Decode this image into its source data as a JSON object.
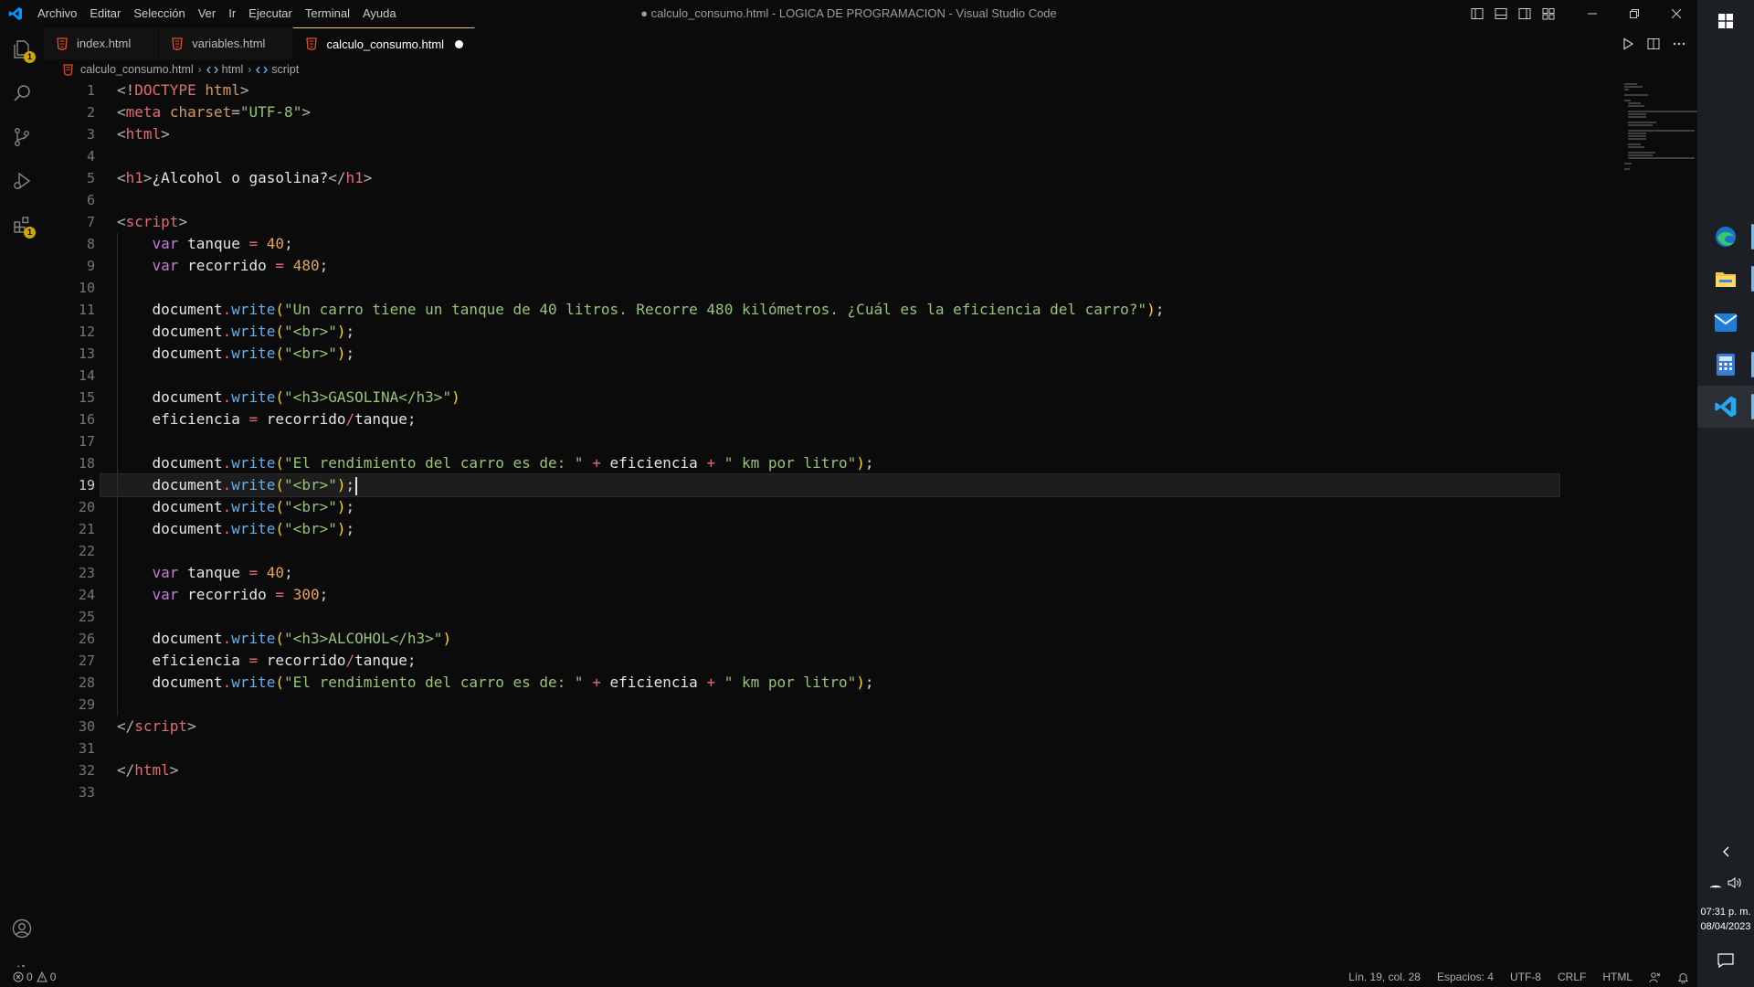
{
  "titlebar": {
    "menu": [
      "Archivo",
      "Editar",
      "Selección",
      "Ver",
      "Ir",
      "Ejecutar",
      "Terminal",
      "Ayuda"
    ],
    "window_title": "● calculo_consumo.html - LOGICA DE PROGRAMACION - Visual Studio Code"
  },
  "activity_bar": {
    "explorer_badge": "1",
    "extensions_badge": "1"
  },
  "tabs": [
    {
      "label": "index.html",
      "active": false,
      "dirty": false
    },
    {
      "label": "variables.html",
      "active": false,
      "dirty": false
    },
    {
      "label": "calculo_consumo.html",
      "active": true,
      "dirty": true
    }
  ],
  "breadcrumb": {
    "file": "calculo_consumo.html",
    "node1": "html",
    "node2": "script"
  },
  "editor": {
    "active_line": 19,
    "lines": [
      [
        [
          "p",
          "<!"
        ],
        [
          "t",
          "DOCTYPE"
        ],
        [
          "p",
          " "
        ],
        [
          "a",
          "html"
        ],
        [
          "p",
          ">"
        ]
      ],
      [
        [
          "p",
          "<"
        ],
        [
          "t",
          "meta"
        ],
        [
          "p",
          " "
        ],
        [
          "a",
          "charset"
        ],
        [
          "p",
          "="
        ],
        [
          "s",
          "\"UTF-8\""
        ],
        [
          "p",
          ">"
        ]
      ],
      [
        [
          "p",
          "<"
        ],
        [
          "t",
          "html"
        ],
        [
          "p",
          ">"
        ]
      ],
      [],
      [
        [
          "p",
          "<"
        ],
        [
          "t",
          "h1"
        ],
        [
          "p",
          ">"
        ],
        [
          "x",
          "¿Alcohol o gasolina?"
        ],
        [
          "p",
          "</"
        ],
        [
          "t",
          "h1"
        ],
        [
          "p",
          ">"
        ]
      ],
      [],
      [
        [
          "p",
          "<"
        ],
        [
          "t",
          "script"
        ],
        [
          "p",
          ">"
        ]
      ],
      [
        [
          "w",
          "    "
        ],
        [
          "k",
          "var"
        ],
        [
          "w",
          " "
        ],
        [
          "i",
          "tanque"
        ],
        [
          "w",
          " "
        ],
        [
          "o",
          "="
        ],
        [
          "w",
          " "
        ],
        [
          "n",
          "40"
        ],
        [
          "w",
          ";"
        ]
      ],
      [
        [
          "w",
          "    "
        ],
        [
          "k",
          "var"
        ],
        [
          "w",
          " "
        ],
        [
          "i",
          "recorrido"
        ],
        [
          "w",
          " "
        ],
        [
          "o",
          "="
        ],
        [
          "w",
          " "
        ],
        [
          "n",
          "480"
        ],
        [
          "w",
          ";"
        ]
      ],
      [],
      [
        [
          "w",
          "    "
        ],
        [
          "i",
          "document"
        ],
        [
          "o",
          "."
        ],
        [
          "f",
          "write"
        ],
        [
          "b",
          "("
        ],
        [
          "s",
          "\"Un carro tiene un tanque de 40 litros. Recorre 480 kilómetros. ¿Cuál es la eficiencia del carro?\""
        ],
        [
          "b",
          ")"
        ],
        [
          "w",
          ";"
        ]
      ],
      [
        [
          "w",
          "    "
        ],
        [
          "i",
          "document"
        ],
        [
          "o",
          "."
        ],
        [
          "f",
          "write"
        ],
        [
          "b",
          "("
        ],
        [
          "s",
          "\"<br>\""
        ],
        [
          "b",
          ")"
        ],
        [
          "w",
          ";"
        ]
      ],
      [
        [
          "w",
          "    "
        ],
        [
          "i",
          "document"
        ],
        [
          "o",
          "."
        ],
        [
          "f",
          "write"
        ],
        [
          "b",
          "("
        ],
        [
          "s",
          "\"<br>\""
        ],
        [
          "b",
          ")"
        ],
        [
          "w",
          ";"
        ]
      ],
      [],
      [
        [
          "w",
          "    "
        ],
        [
          "i",
          "document"
        ],
        [
          "o",
          "."
        ],
        [
          "f",
          "write"
        ],
        [
          "b",
          "("
        ],
        [
          "s",
          "\"<h3>GASOLINA</h3>\""
        ],
        [
          "b",
          ")"
        ]
      ],
      [
        [
          "w",
          "    "
        ],
        [
          "i",
          "eficiencia"
        ],
        [
          "w",
          " "
        ],
        [
          "o",
          "="
        ],
        [
          "w",
          " "
        ],
        [
          "i",
          "recorrido"
        ],
        [
          "o",
          "/"
        ],
        [
          "i",
          "tanque"
        ],
        [
          "w",
          ";"
        ]
      ],
      [],
      [
        [
          "w",
          "    "
        ],
        [
          "i",
          "document"
        ],
        [
          "o",
          "."
        ],
        [
          "f",
          "write"
        ],
        [
          "b",
          "("
        ],
        [
          "s",
          "\"El rendimiento del carro es de: \""
        ],
        [
          "w",
          " "
        ],
        [
          "o",
          "+"
        ],
        [
          "w",
          " "
        ],
        [
          "i",
          "eficiencia"
        ],
        [
          "w",
          " "
        ],
        [
          "o",
          "+"
        ],
        [
          "w",
          " "
        ],
        [
          "s",
          "\" km por litro\""
        ],
        [
          "b",
          ")"
        ],
        [
          "w",
          ";"
        ]
      ],
      [
        [
          "w",
          "    "
        ],
        [
          "i",
          "document"
        ],
        [
          "o",
          "."
        ],
        [
          "f",
          "write"
        ],
        [
          "b",
          "("
        ],
        [
          "s",
          "\"<br>\""
        ],
        [
          "b",
          ")"
        ],
        [
          "w",
          ";"
        ]
      ],
      [
        [
          "w",
          "    "
        ],
        [
          "i",
          "document"
        ],
        [
          "o",
          "."
        ],
        [
          "f",
          "write"
        ],
        [
          "b",
          "("
        ],
        [
          "s",
          "\"<br>\""
        ],
        [
          "b",
          ")"
        ],
        [
          "w",
          ";"
        ]
      ],
      [
        [
          "w",
          "    "
        ],
        [
          "i",
          "document"
        ],
        [
          "o",
          "."
        ],
        [
          "f",
          "write"
        ],
        [
          "b",
          "("
        ],
        [
          "s",
          "\"<br>\""
        ],
        [
          "b",
          ")"
        ],
        [
          "w",
          ";"
        ]
      ],
      [],
      [
        [
          "w",
          "    "
        ],
        [
          "k",
          "var"
        ],
        [
          "w",
          " "
        ],
        [
          "i",
          "tanque"
        ],
        [
          "w",
          " "
        ],
        [
          "o",
          "="
        ],
        [
          "w",
          " "
        ],
        [
          "n",
          "40"
        ],
        [
          "w",
          ";"
        ]
      ],
      [
        [
          "w",
          "    "
        ],
        [
          "k",
          "var"
        ],
        [
          "w",
          " "
        ],
        [
          "i",
          "recorrido"
        ],
        [
          "w",
          " "
        ],
        [
          "o",
          "="
        ],
        [
          "w",
          " "
        ],
        [
          "n",
          "300"
        ],
        [
          "w",
          ";"
        ]
      ],
      [],
      [
        [
          "w",
          "    "
        ],
        [
          "i",
          "document"
        ],
        [
          "o",
          "."
        ],
        [
          "f",
          "write"
        ],
        [
          "b",
          "("
        ],
        [
          "s",
          "\"<h3>ALCOHOL</h3>\""
        ],
        [
          "b",
          ")"
        ]
      ],
      [
        [
          "w",
          "    "
        ],
        [
          "i",
          "eficiencia"
        ],
        [
          "w",
          " "
        ],
        [
          "o",
          "="
        ],
        [
          "w",
          " "
        ],
        [
          "i",
          "recorrido"
        ],
        [
          "o",
          "/"
        ],
        [
          "i",
          "tanque"
        ],
        [
          "w",
          ";"
        ]
      ],
      [
        [
          "w",
          "    "
        ],
        [
          "i",
          "document"
        ],
        [
          "o",
          "."
        ],
        [
          "f",
          "write"
        ],
        [
          "b",
          "("
        ],
        [
          "s",
          "\"El rendimiento del carro es de: \""
        ],
        [
          "w",
          " "
        ],
        [
          "o",
          "+"
        ],
        [
          "w",
          " "
        ],
        [
          "i",
          "eficiencia"
        ],
        [
          "w",
          " "
        ],
        [
          "o",
          "+"
        ],
        [
          "w",
          " "
        ],
        [
          "s",
          "\" km por litro\""
        ],
        [
          "b",
          ")"
        ],
        [
          "w",
          ";"
        ]
      ],
      [],
      [
        [
          "p",
          "</"
        ],
        [
          "t",
          "script"
        ],
        [
          "p",
          ">"
        ]
      ],
      [],
      [
        [
          "p",
          "</"
        ],
        [
          "t",
          "html"
        ],
        [
          "p",
          ">"
        ]
      ],
      []
    ]
  },
  "statusbar": {
    "errors": "0",
    "warnings": "0",
    "position": "Lín. 19, col. 28",
    "spaces": "Espacios: 4",
    "encoding": "UTF-8",
    "eol": "CRLF",
    "language": "HTML"
  },
  "taskbar": {
    "time": "07:31 p. m.",
    "date": "08/04/2023"
  },
  "colors": {
    "accent_tab": "#e2c08d",
    "vscode_blue": "#0098ff",
    "html_file_icon": "#e44d26",
    "badge": "#cca700"
  }
}
